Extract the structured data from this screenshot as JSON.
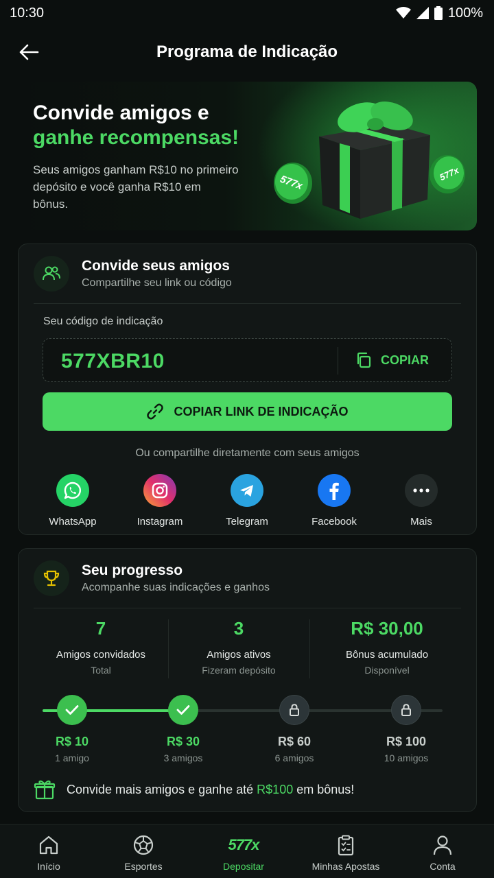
{
  "status": {
    "time": "10:30",
    "battery": "100%"
  },
  "header": {
    "title": "Programa de Indicação"
  },
  "hero": {
    "title_line1": "Convide amigos e",
    "title_line2": "ganhe recompensas!",
    "description": "Seus amigos ganham R$10 no primeiro depósito e você ganha R$10 em bônus.",
    "coin_logo": "577x"
  },
  "invite": {
    "title": "Convide seus amigos",
    "subtitle": "Compartilhe seu link ou código",
    "code_label": "Seu código de indicação",
    "code": "577XBR10",
    "copy_label": "COPIAR",
    "link_button": "COPIAR LINK DE INDICAÇÃO",
    "share_caption": "Ou compartilhe diretamente com seus amigos",
    "share": [
      {
        "label": "WhatsApp",
        "icon": "whatsapp-icon",
        "color": "#25d366"
      },
      {
        "label": "Instagram",
        "icon": "instagram-icon",
        "color": "#e1306c"
      },
      {
        "label": "Telegram",
        "icon": "telegram-icon",
        "color": "#2aa3e0"
      },
      {
        "label": "Facebook",
        "icon": "facebook-icon",
        "color": "#1877f2"
      },
      {
        "label": "Mais",
        "icon": "more-icon",
        "color": "#2a3131"
      }
    ]
  },
  "progress": {
    "title": "Seu progresso",
    "subtitle": "Acompanhe suas indicações e ganhos",
    "stats": [
      {
        "value": "7",
        "label": "Amigos convidados",
        "sub": "Total"
      },
      {
        "value": "3",
        "label": "Amigos ativos",
        "sub": "Fizeram depósito"
      },
      {
        "value": "R$ 30,00",
        "label": "Bônus acumulado",
        "sub": "Disponível"
      }
    ],
    "milestones": [
      {
        "value": "R$ 10",
        "sub": "1 amigo",
        "done": true
      },
      {
        "value": "R$ 30",
        "sub": "3 amigos",
        "done": true
      },
      {
        "value": "R$ 60",
        "sub": "6 amigos",
        "done": false
      },
      {
        "value": "R$ 100",
        "sub": "10 amigos",
        "done": false
      }
    ],
    "note_prefix": "Convide mais amigos e ganhe até ",
    "note_highlight": "R$100",
    "note_suffix": " em bônus!"
  },
  "nav": [
    {
      "label": "Início",
      "icon": "home-icon"
    },
    {
      "label": "Esportes",
      "icon": "ball-icon"
    },
    {
      "label": "Depositar",
      "icon": "577x-logo",
      "logo_text": "577x",
      "active": true
    },
    {
      "label": "Minhas Apostas",
      "icon": "clipboard-icon"
    },
    {
      "label": "Conta",
      "icon": "user-icon"
    }
  ],
  "colors": {
    "accent": "#4cd964",
    "background": "#0b0f0e",
    "card": "#121716"
  }
}
